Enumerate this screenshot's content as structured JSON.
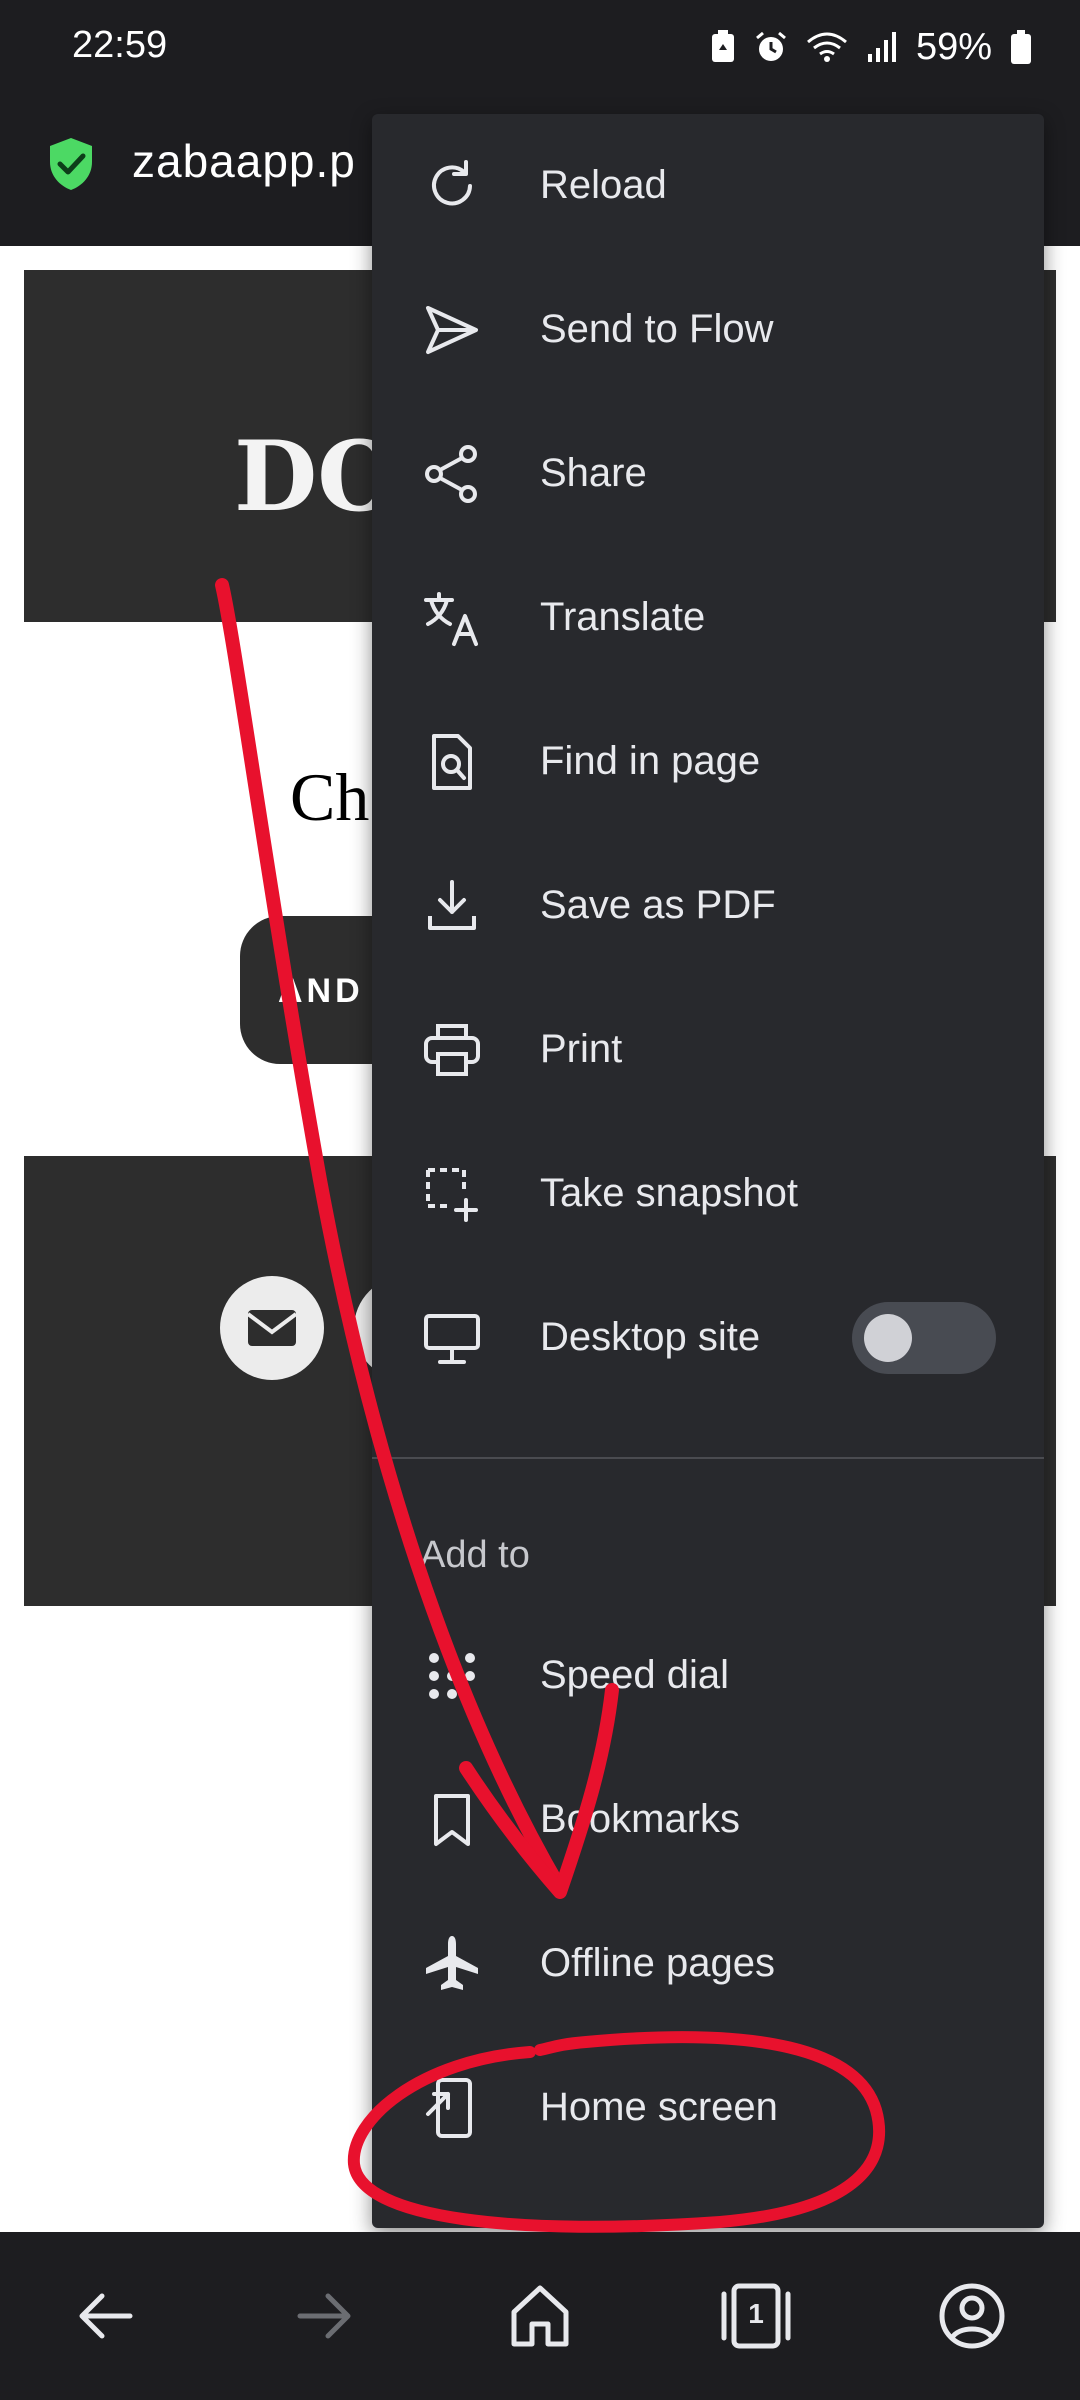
{
  "status_bar": {
    "time": "22:59",
    "battery": "59%",
    "icons": [
      "battery-saver-icon",
      "alarm-icon",
      "wifi-icon",
      "signal-icon",
      "battery-icon"
    ]
  },
  "address_bar": {
    "url": "zabaapp.p"
  },
  "page": {
    "hero_title": "DO",
    "body_text": "Ch",
    "button_label": "AND"
  },
  "menu": {
    "items": [
      {
        "label": "Reload",
        "icon": "reload-icon"
      },
      {
        "label": "Send to Flow",
        "icon": "send-icon"
      },
      {
        "label": "Share",
        "icon": "share-icon"
      },
      {
        "label": "Translate",
        "icon": "translate-icon"
      },
      {
        "label": "Find in page",
        "icon": "find-in-page-icon"
      },
      {
        "label": "Save as PDF",
        "icon": "download-icon"
      },
      {
        "label": "Print",
        "icon": "print-icon"
      },
      {
        "label": "Take snapshot",
        "icon": "snapshot-icon"
      },
      {
        "label": "Desktop site",
        "icon": "desktop-icon",
        "toggle": false
      }
    ],
    "add_to_header": "Add to",
    "add_to_items": [
      {
        "label": "Speed dial",
        "icon": "speed-dial-icon"
      },
      {
        "label": "Bookmarks",
        "icon": "bookmark-icon"
      },
      {
        "label": "Offline pages",
        "icon": "airplane-icon"
      },
      {
        "label": "Home screen",
        "icon": "add-to-home-screen-icon"
      }
    ]
  },
  "bottom_nav": {
    "tab_count": "1",
    "icons": [
      "back-arrow-icon",
      "forward-arrow-icon",
      "home-icon",
      "tabs-icon",
      "account-icon"
    ]
  },
  "colors": {
    "menu_bg": "#28292d",
    "bar_bg": "#1d1d20",
    "annotation": "#e8112d",
    "shield": "#4cd964"
  }
}
